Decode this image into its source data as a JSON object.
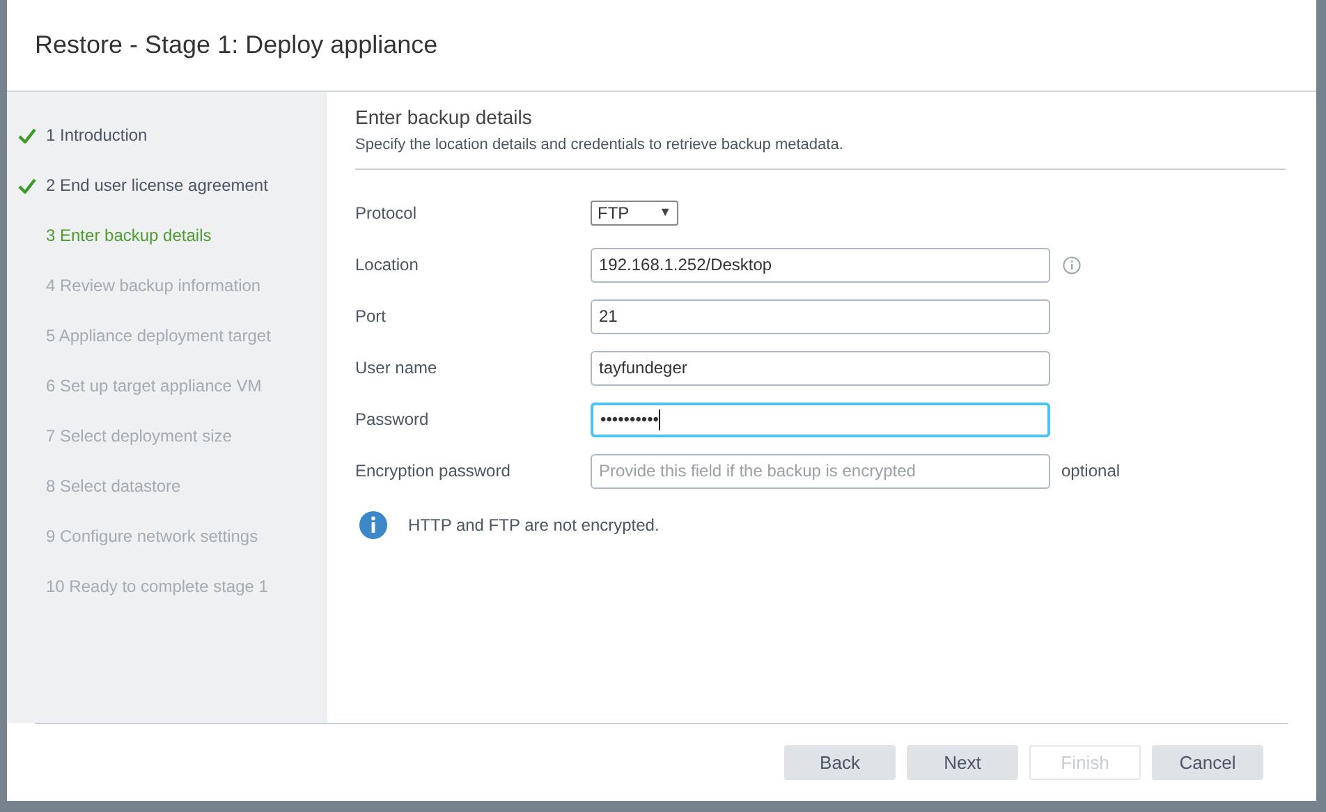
{
  "window": {
    "title": "Restore - Stage 1: Deploy appliance"
  },
  "steps": [
    {
      "label": "1 Introduction",
      "completed": true,
      "selected": false
    },
    {
      "label": "2 End user license agreement",
      "completed": true,
      "selected": false
    },
    {
      "label": "3 Enter backup details",
      "completed": false,
      "selected": true
    },
    {
      "label": "4 Review backup information",
      "completed": false,
      "selected": false
    },
    {
      "label": "5 Appliance deployment target",
      "completed": false,
      "selected": false
    },
    {
      "label": "6 Set up target appliance VM",
      "completed": false,
      "selected": false
    },
    {
      "label": "7 Select deployment size",
      "completed": false,
      "selected": false
    },
    {
      "label": "8 Select datastore",
      "completed": false,
      "selected": false
    },
    {
      "label": "9 Configure network settings",
      "completed": false,
      "selected": false
    },
    {
      "label": "10 Ready to complete stage 1",
      "completed": false,
      "selected": false
    }
  ],
  "page": {
    "heading": "Enter backup details",
    "subheading": "Specify the location details and credentials to retrieve backup metadata."
  },
  "fields": [
    {
      "kind": "select",
      "label": "Protocol",
      "value": "FTP",
      "caret": "▼"
    },
    {
      "kind": "text",
      "label": "Location",
      "value": "192.168.1.252/Desktop",
      "info": true
    },
    {
      "kind": "text",
      "label": "Port",
      "value": "21"
    },
    {
      "kind": "text",
      "label": "User name",
      "value": "tayfundeger"
    },
    {
      "kind": "text",
      "label": "Password",
      "value": "••••••••••",
      "focused": true
    },
    {
      "kind": "text",
      "label": "Encryption password",
      "placeholder": "Provide this field if the backup is encrypted",
      "suffix": "optional"
    }
  ],
  "notice": {
    "text": "HTTP and FTP are not encrypted."
  },
  "buttons": [
    {
      "label": "Back",
      "disabled": false
    },
    {
      "label": "Next",
      "disabled": false
    },
    {
      "label": "Finish",
      "disabled": true
    },
    {
      "label": "Cancel",
      "disabled": false
    }
  ]
}
